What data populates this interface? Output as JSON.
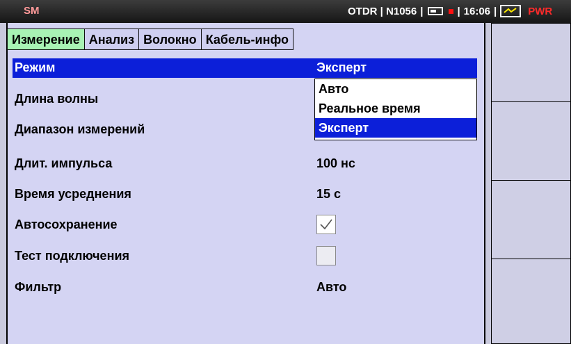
{
  "status_bar": {
    "mode": "SM",
    "device": "OTDR | N1056",
    "separator": "|",
    "time": "16:06",
    "power_label": "PWR"
  },
  "tabs": [
    {
      "label": "Измерение"
    },
    {
      "label": "Анализ"
    },
    {
      "label": "Волокно"
    },
    {
      "label": "Кабель-инфо"
    }
  ],
  "settings": {
    "mode": {
      "label": "Режим",
      "value": "Эксперт"
    },
    "wavelength": {
      "label": "Длина волны"
    },
    "range": {
      "label": "Диапазон измерений"
    },
    "pulse": {
      "label": "Длит. импульса",
      "value": "100 нс"
    },
    "averaging": {
      "label": "Время усреднения",
      "value": "15 с"
    },
    "autosave": {
      "label": "Автосохранение",
      "checked": true
    },
    "connection_test": {
      "label": "Тест подключения",
      "checked": false
    },
    "filter": {
      "label": "Фильтр",
      "value": "Авто"
    }
  },
  "mode_dropdown": {
    "options": [
      "Авто",
      "Реальное время",
      "Эксперт"
    ],
    "selected": "Эксперт"
  },
  "colors": {
    "panel_bg": "#d4d4f3",
    "active_tab": "#a8f3b4",
    "highlight": "#0c1fd9",
    "pwr_red": "#ff2a2a"
  }
}
